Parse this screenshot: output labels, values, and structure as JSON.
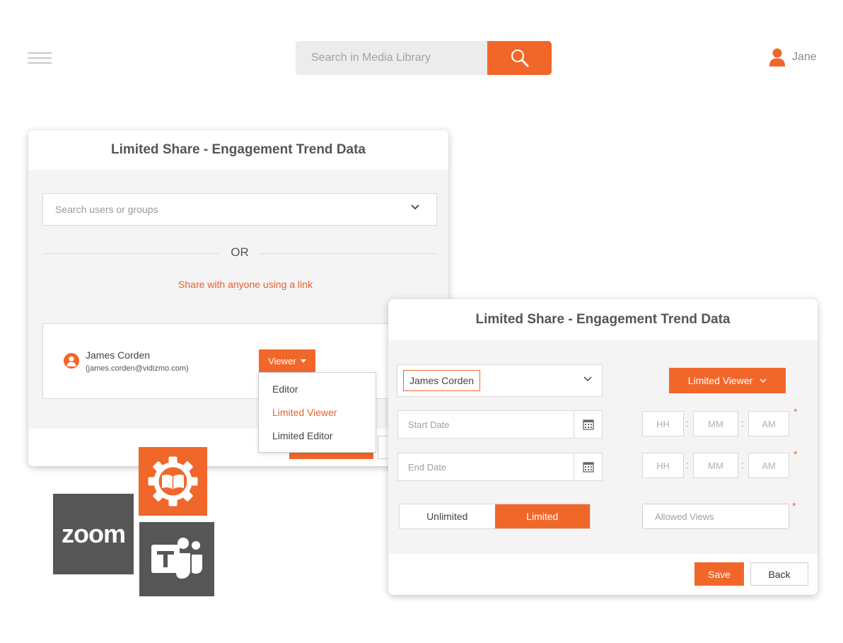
{
  "topbar": {
    "search_placeholder": "Search in Media Library",
    "user_name": "Jane"
  },
  "share_dialog": {
    "title": "Limited Share - Engagement Trend Data",
    "search_placeholder": "Search users or groups",
    "or_label": "OR",
    "share_link_label": "Share with anyone using a link",
    "user": {
      "name": "James Corden",
      "email": "(james.corden@vidizmo.com)"
    },
    "role_button": "Viewer",
    "role_options": [
      "Editor",
      "Limited Viewer",
      "Limited Editor"
    ],
    "role_option_highlighted": "Limited Viewer"
  },
  "limited_dialog": {
    "title": "Limited Share - Engagement Trend Data",
    "selected_user": "James Corden",
    "role_button": "Limited Viewer",
    "start_date_placeholder": "Start Date",
    "end_date_placeholder": "End Date",
    "hh_placeholder": "HH",
    "mm_placeholder": "MM",
    "ampm_placeholder": "AM",
    "required_mark": "*",
    "toggle": {
      "unlimited": "Unlimited",
      "limited": "Limited",
      "selected": "Limited"
    },
    "allowed_views_placeholder": "Allowed Views",
    "save_label": "Save",
    "back_label": "Back"
  },
  "logos": {
    "zoom_text": "zoom"
  },
  "colors": {
    "accent": "#f1672a",
    "panel": "#f4f4f5",
    "tile_gray": "#565656"
  }
}
